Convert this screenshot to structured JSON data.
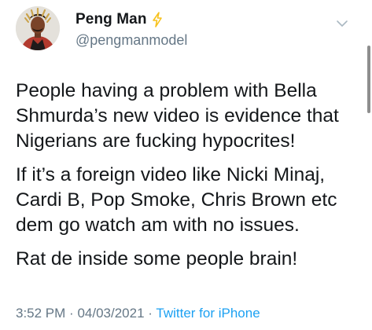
{
  "author": {
    "display_name": "Peng Man",
    "handle": "@pengmanmodel",
    "badge_color": "#f7c21d"
  },
  "tweet": {
    "paragraphs": [
      "People having a problem with Bella Shmurda’s new video is evidence that Nigerians are fucking hypocrites!",
      "If it’s a foreign video like Nicki Minaj, Cardi B, Pop Smoke, Chris Brown etc dem go watch am with no issues.",
      "Rat de inside some people brain!"
    ]
  },
  "meta": {
    "time": "3:52 PM",
    "separator": "·",
    "date": "04/03/2021",
    "source": "Twitter for iPhone"
  },
  "colors": {
    "text": "#14171a",
    "muted": "#657786",
    "link": "#1da1f2"
  },
  "icons": {
    "badge": "lightning-bolt-icon",
    "menu": "chevron-down-icon"
  }
}
